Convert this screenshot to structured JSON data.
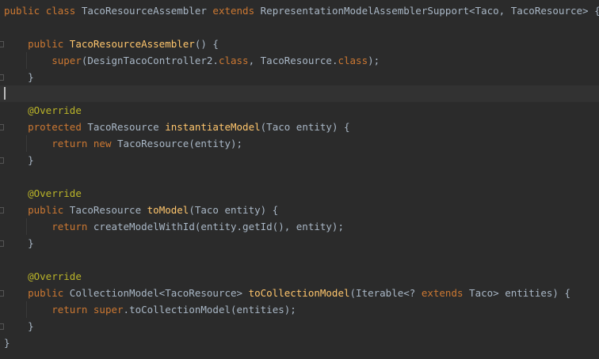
{
  "editor": {
    "lines": [
      [
        {
          "t": "kw",
          "v": "public "
        },
        {
          "t": "kw",
          "v": "class "
        },
        {
          "t": "pl",
          "v": "TacoResourceAssembler "
        },
        {
          "t": "kw",
          "v": "extends "
        },
        {
          "t": "pl",
          "v": "RepresentationModelAssemblerSupport<Taco, TacoResource> {"
        }
      ],
      [],
      [
        {
          "t": "pl",
          "v": "    "
        },
        {
          "t": "kw",
          "v": "public "
        },
        {
          "t": "fn",
          "v": "TacoResourceAssembler"
        },
        {
          "t": "pl",
          "v": "() {"
        }
      ],
      [
        {
          "t": "pl",
          "v": "        "
        },
        {
          "t": "kw",
          "v": "super"
        },
        {
          "t": "pl",
          "v": "(DesignTacoController2."
        },
        {
          "t": "kw",
          "v": "class"
        },
        {
          "t": "pl",
          "v": ", TacoResource."
        },
        {
          "t": "kw",
          "v": "class"
        },
        {
          "t": "pl",
          "v": ");"
        }
      ],
      [
        {
          "t": "pl",
          "v": "    }"
        }
      ],
      [],
      [
        {
          "t": "pl",
          "v": "    "
        },
        {
          "t": "ann",
          "v": "@Override"
        }
      ],
      [
        {
          "t": "pl",
          "v": "    "
        },
        {
          "t": "kw",
          "v": "protected "
        },
        {
          "t": "pl",
          "v": "TacoResource "
        },
        {
          "t": "fn",
          "v": "instantiateModel"
        },
        {
          "t": "pl",
          "v": "(Taco entity) {"
        }
      ],
      [
        {
          "t": "pl",
          "v": "        "
        },
        {
          "t": "kw",
          "v": "return new "
        },
        {
          "t": "pl",
          "v": "TacoResource(entity);"
        }
      ],
      [
        {
          "t": "pl",
          "v": "    }"
        }
      ],
      [],
      [
        {
          "t": "pl",
          "v": "    "
        },
        {
          "t": "ann",
          "v": "@Override"
        }
      ],
      [
        {
          "t": "pl",
          "v": "    "
        },
        {
          "t": "kw",
          "v": "public "
        },
        {
          "t": "pl",
          "v": "TacoResource "
        },
        {
          "t": "fn",
          "v": "toModel"
        },
        {
          "t": "pl",
          "v": "(Taco entity) {"
        }
      ],
      [
        {
          "t": "pl",
          "v": "        "
        },
        {
          "t": "kw",
          "v": "return "
        },
        {
          "t": "pl",
          "v": "createModelWithId(entity.getId(), entity);"
        }
      ],
      [
        {
          "t": "pl",
          "v": "    }"
        }
      ],
      [],
      [
        {
          "t": "pl",
          "v": "    "
        },
        {
          "t": "ann",
          "v": "@Override"
        }
      ],
      [
        {
          "t": "pl",
          "v": "    "
        },
        {
          "t": "kw",
          "v": "public "
        },
        {
          "t": "pl",
          "v": "CollectionModel<TacoResource> "
        },
        {
          "t": "fn",
          "v": "toCollectionModel"
        },
        {
          "t": "pl",
          "v": "(Iterable<? "
        },
        {
          "t": "kw",
          "v": "extends "
        },
        {
          "t": "pl",
          "v": "Taco> entities) {"
        }
      ],
      [
        {
          "t": "pl",
          "v": "        "
        },
        {
          "t": "kw",
          "v": "return "
        },
        {
          "t": "kw",
          "v": "super"
        },
        {
          "t": "pl",
          "v": ".toCollectionModel(entities);"
        }
      ],
      [
        {
          "t": "pl",
          "v": "    }"
        }
      ],
      [
        {
          "t": "pl",
          "v": "}"
        }
      ]
    ],
    "current_line": 5,
    "fold_markers": [
      2,
      4,
      7,
      9,
      12,
      14,
      17,
      19
    ]
  },
  "colors": {
    "background": "#2b2b2b",
    "current_line": "#323232",
    "keyword": "#cc7832",
    "method": "#ffc66d",
    "annotation": "#bbb529",
    "plain": "#a9b7c6"
  }
}
